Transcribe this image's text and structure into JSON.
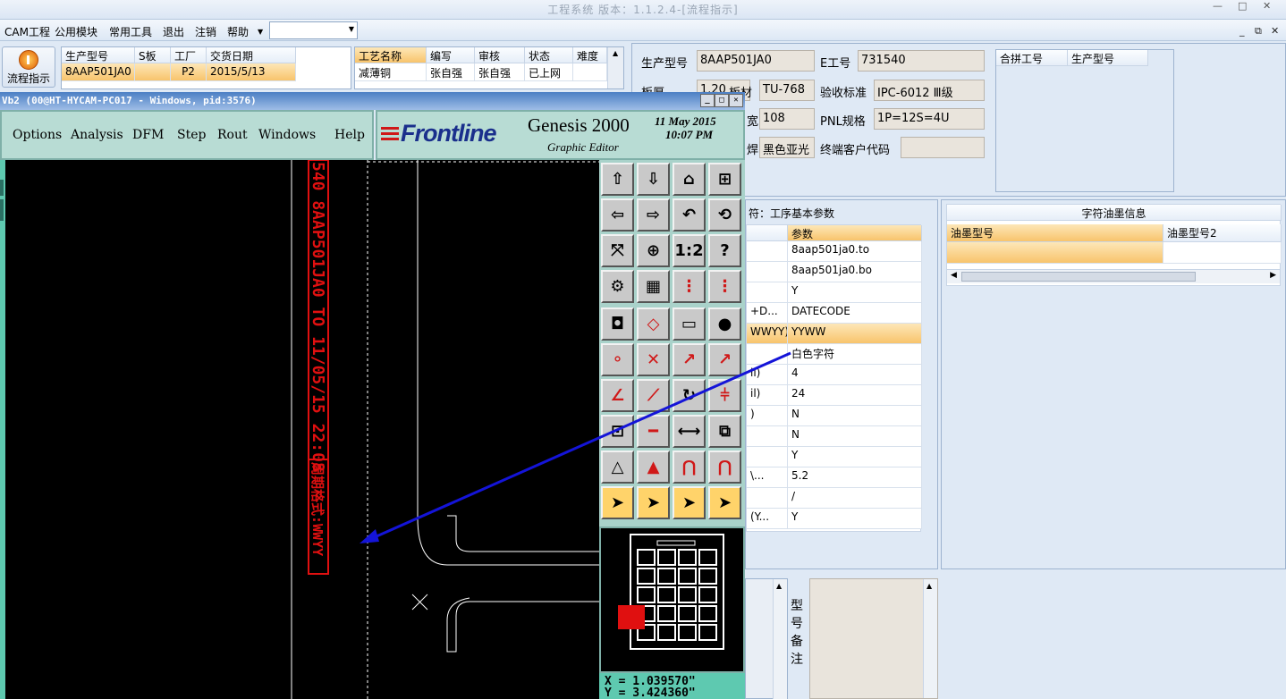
{
  "window": {
    "title": "工程系统 版本：1.1.2.4-[流程指示]",
    "controls": [
      "—",
      "□",
      "✕"
    ]
  },
  "menu": {
    "items": [
      "CAM工程",
      "公用模块",
      "常用工具",
      "退出",
      "注销",
      "帮助"
    ],
    "combo_value": "",
    "mdi_controls": [
      "_",
      "⧉",
      "✕"
    ]
  },
  "flow_button": {
    "label": "流程指示"
  },
  "order_grid": {
    "headers": [
      "生产型号",
      "S板",
      "工厂",
      "交货日期"
    ],
    "row": [
      "8AAP501JA0",
      "",
      "P2",
      "2015/5/13"
    ]
  },
  "process_grid": {
    "headers": [
      "工艺名称",
      "编写",
      "审核",
      "状态",
      "难度"
    ],
    "row": [
      "减薄铜",
      "张自强",
      "张自强",
      "已上网",
      ""
    ]
  },
  "info": {
    "prod_model_label": "生产型号",
    "prod_model": "8AAP501JA0",
    "e_no_label": "E工号",
    "e_no": "731540",
    "thickness_label": "板厚",
    "thickness": "1.20",
    "material_label": "板材",
    "material": "TU-768",
    "standard_label": "验收标准",
    "standard": "IPC-6012 Ⅲ级",
    "field3_label": "宽",
    "field3": "108",
    "pnl_label": "PNL规格",
    "pnl": "1P=12S=4U",
    "solder_label": "焊",
    "solder": "黑色亚光",
    "customer_label": "终端客户代码",
    "customer": ""
  },
  "merge_grid": {
    "headers": [
      "合拼工号",
      "生产型号"
    ]
  },
  "params": {
    "title": "符：工序基本参数",
    "header": "参数",
    "rows": [
      {
        "k": "",
        "v": "8aap501ja0.to"
      },
      {
        "k": "",
        "v": "8aap501ja0.bo"
      },
      {
        "k": "",
        "v": "Y"
      },
      {
        "k": "+D...",
        "v": "DATECODE"
      },
      {
        "k": "WWYY)",
        "v": "YYWW"
      },
      {
        "k": "",
        "v": "白色字符"
      },
      {
        "k": "il)",
        "v": "4"
      },
      {
        "k": "il)",
        "v": "24"
      },
      {
        "k": ")",
        "v": "N"
      },
      {
        "k": "",
        "v": "N"
      },
      {
        "k": "",
        "v": "Y"
      },
      {
        "k": "\\...",
        "v": "5.2"
      },
      {
        "k": "",
        "v": "/"
      },
      {
        "k": "(Y...",
        "v": "Y"
      }
    ]
  },
  "ink": {
    "title": "字符油墨信息",
    "headers": [
      "油墨型号",
      "油墨型号2"
    ]
  },
  "remark": {
    "label": "型号备注"
  },
  "genesis": {
    "title": "Vb2 (00@HT-HYCAM-PC017 - Windows, pid:3576)",
    "menus": [
      "Options",
      "Analysis",
      "DFM",
      "Step",
      "Rout",
      "Windows",
      "Help"
    ],
    "logo": "Frontline",
    "product": "Genesis 2000",
    "subtitle": "Graphic Editor",
    "date": "11 May 2015",
    "time": "10:07 PM",
    "coord_x": "X = 1.039570\"",
    "coord_y": "Y = 3.424360\"",
    "board_text_1": "540 8AAP501JA0 TO 11/05/15 22:08",
    "board_text_2": "周期格式:WWYY",
    "tool_icons": [
      [
        "zoom-home-icon",
        "zoom-in-icon",
        "home-icon",
        "window-icon"
      ],
      [
        "pan-left-icon",
        "pan-right-icon",
        "undo-icon",
        "redraw-icon"
      ],
      [
        "fit-icon",
        "center-icon",
        "scale-1to1-icon",
        "help-icon"
      ],
      [
        "tools-icon",
        "grid-icon",
        "snap-icon",
        "layer-icon"
      ],
      [
        "select-icon",
        "rect-icon",
        "measure-icon",
        "pad-icon"
      ],
      [
        "connect-icon",
        "delete-icon",
        "move-icon",
        "copy-icon"
      ],
      [
        "line-icon",
        "arc-icon",
        "rotate-icon",
        "mirror-icon"
      ],
      [
        "resize-icon",
        "cut-icon",
        "break-icon",
        "merge-icon"
      ],
      [
        "triangle-icon",
        "add-icon",
        "arch-icon",
        "poly-icon"
      ],
      [
        "pointer-icon",
        "pointer-box-icon",
        "pointer-circle-icon",
        "pointer-net-icon"
      ]
    ]
  }
}
